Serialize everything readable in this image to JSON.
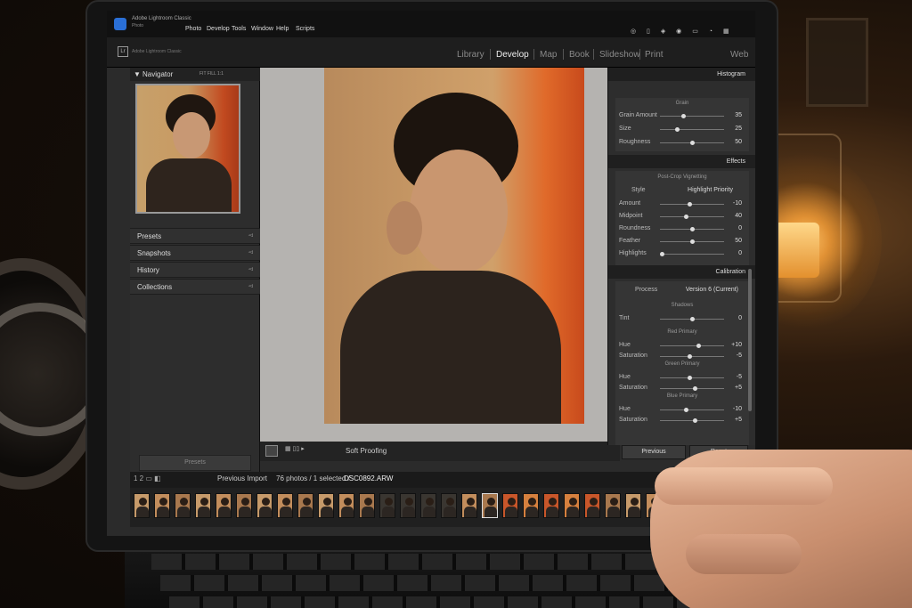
{
  "menubar": {
    "app_title": "Adobe Lightroom Classic",
    "app_sub": "Photo",
    "items": [
      "Photo",
      "Develop",
      "Tools",
      "Window",
      "Help",
      "Scripts"
    ],
    "status_icons": "◎ ▯ ◈ ◉ ▭ ◔ ▦"
  },
  "modulebar": {
    "logo": "Lr",
    "name": "Adobe Lightroom Classic",
    "modules": [
      "Library",
      "Develop",
      "Map",
      "Book",
      "Slideshow",
      "Print",
      "Web"
    ],
    "active": "Develop"
  },
  "left": {
    "navigator_label": "Navigator",
    "navigator_controls": "FIT  FILL  1:1",
    "sections": [
      "Presets",
      "Snapshots",
      "History",
      "Collections"
    ],
    "presets_button": "Presets"
  },
  "toolbar": {
    "icons": "▦ ▯▯ ▸",
    "soft_proofing": "Soft Proofing"
  },
  "right": {
    "histogram_label": "Histogram",
    "grain": {
      "title": "Grain",
      "rows": [
        {
          "label": "Grain Amount",
          "value": "35",
          "pos": 0.35
        },
        {
          "label": "Size",
          "value": "25",
          "pos": 0.25
        },
        {
          "label": "Roughness",
          "value": "50",
          "pos": 0.5
        }
      ]
    },
    "effects_label": "Effects",
    "vignette": {
      "title": "Post-Crop Vignetting",
      "style_label": "Style",
      "style_value": "Highlight Priority",
      "rows": [
        {
          "label": "Amount",
          "value": "-10",
          "pos": 0.45
        },
        {
          "label": "Midpoint",
          "value": "40",
          "pos": 0.4
        },
        {
          "label": "Roundness",
          "value": "0",
          "pos": 0.5
        },
        {
          "label": "Feather",
          "value": "50",
          "pos": 0.5
        },
        {
          "label": "Highlights",
          "value": "0",
          "pos": 0.0
        }
      ]
    },
    "calibration_label": "Calibration",
    "calibration": {
      "process_label": "Process",
      "process_value": "Version 6 (Current)",
      "shadows_title": "Shadows",
      "tint": {
        "label": "Tint",
        "value": "0",
        "pos": 0.5
      },
      "red_title": "Red Primary",
      "red": [
        {
          "label": "Hue",
          "value": "+10",
          "pos": 0.6
        },
        {
          "label": "Saturation",
          "value": "-5",
          "pos": 0.45
        }
      ],
      "green_title": "Green Primary",
      "green": [
        {
          "label": "Hue",
          "value": "-5",
          "pos": 0.45
        },
        {
          "label": "Saturation",
          "value": "+5",
          "pos": 0.55
        }
      ],
      "blue_title": "Blue Primary",
      "blue": [
        {
          "label": "Hue",
          "value": "-10",
          "pos": 0.4
        },
        {
          "label": "Saturation",
          "value": "+5",
          "pos": 0.55
        }
      ]
    },
    "previous_button": "Previous",
    "reset_button": "Reset"
  },
  "filmstrip": {
    "page_icons": "1  2  ▭  ◧",
    "source": "Previous Import",
    "count": "76 photos / 1 selected /",
    "filename": "DSC0892.ARW",
    "thumb_count": 30
  },
  "colors": {
    "accent_selected": "#dddddd",
    "panel_bg": "#2d2d2d",
    "photo_orange": "#e06a2a"
  }
}
